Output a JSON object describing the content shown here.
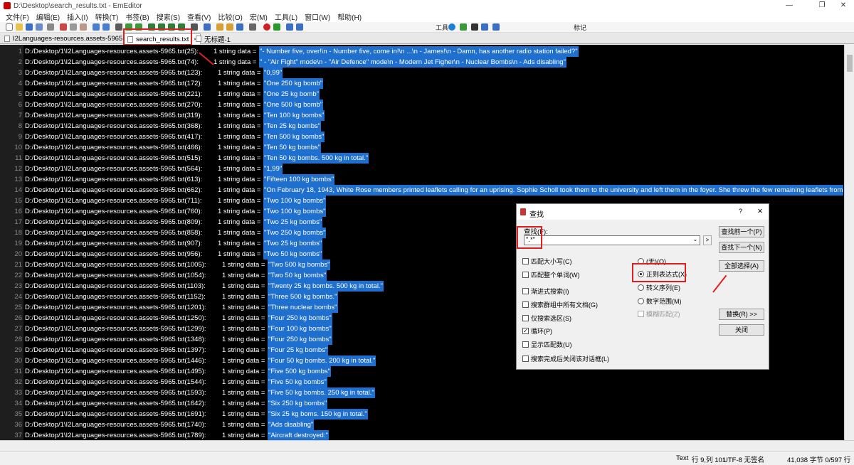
{
  "window": {
    "title": "D:\\Desktop\\search_results.txt - EmEditor",
    "minimize": "—",
    "maximize": "❐",
    "close": "✕"
  },
  "menu": [
    "文件(F)",
    "编辑(E)",
    "插入(I)",
    "转换(T)",
    "书签(B)",
    "搜索(S)",
    "查看(V)",
    "比较(O)",
    "宏(M)",
    "工具(L)",
    "窗口(W)",
    "帮助(H)"
  ],
  "toolbar": {
    "tools_label": "工具",
    "marks_label": "标记"
  },
  "tabs": [
    {
      "label": "I2Languages-resources.assets-5965.txt"
    },
    {
      "label": "search_results.txt",
      "close": "×"
    },
    {
      "label": "无标题-1"
    }
  ],
  "lines": [
    {
      "n": "1",
      "path": "D:/Desktop/1\\I2Languages-resources.assets-5965.txt(25):",
      "data": "1 string data = ",
      "sel": "\"- Number five, over!\\n - Number five, come in!\\n ...\\n - James!\\n - Damn, has another radio station failed?\""
    },
    {
      "n": "2",
      "path": "D:/Desktop/1\\I2Languages-resources.assets-5965.txt(74):",
      "data": "1 string data = ",
      "sel": "\" - \"Air Fight\" mode\\n - \"Air Defence\" mode\\n - Modern Jet Figher\\n - Nuclear Bombs\\n - Ads disabling\""
    },
    {
      "n": "3",
      "path": "D:/Desktop/1\\I2Languages-resources.assets-5965.txt(123):",
      "data": "1 string data = ",
      "sel": "\"0,99\""
    },
    {
      "n": "4",
      "path": "D:/Desktop/1\\I2Languages-resources.assets-5965.txt(172):",
      "data": "1 string data = ",
      "sel": "\"One 250 kg bomb\""
    },
    {
      "n": "5",
      "path": "D:/Desktop/1\\I2Languages-resources.assets-5965.txt(221):",
      "data": "1 string data = ",
      "sel": "\"One 25 kg bomb\""
    },
    {
      "n": "6",
      "path": "D:/Desktop/1\\I2Languages-resources.assets-5965.txt(270):",
      "data": "1 string data = ",
      "sel": "\"One 500 kg bomb\""
    },
    {
      "n": "7",
      "path": "D:/Desktop/1\\I2Languages-resources.assets-5965.txt(319):",
      "data": "1 string data = ",
      "sel": "\"Ten 100 kg bombs\""
    },
    {
      "n": "8",
      "path": "D:/Desktop/1\\I2Languages-resources.assets-5965.txt(368):",
      "data": "1 string data = ",
      "sel": "\"Ten 25 kg bombs\""
    },
    {
      "n": "9",
      "path": "D:/Desktop/1\\I2Languages-resources.assets-5965.txt(417):",
      "data": "1 string data = ",
      "sel": "\"Ten 500 kg bombs\""
    },
    {
      "n": "10",
      "path": "D:/Desktop/1\\I2Languages-resources.assets-5965.txt(466):",
      "data": "1 string data = ",
      "sel": "\"Ten 50 kg bombs\""
    },
    {
      "n": "11",
      "path": "D:/Desktop/1\\I2Languages-resources.assets-5965.txt(515):",
      "data": "1 string data = ",
      "sel": "\"Ten 50 kg bombs. 500 kg in total.\""
    },
    {
      "n": "12",
      "path": "D:/Desktop/1\\I2Languages-resources.assets-5965.txt(564):",
      "data": "1 string data = ",
      "sel": "\"1,99\""
    },
    {
      "n": "13",
      "path": "D:/Desktop/1\\I2Languages-resources.assets-5965.txt(613):",
      "data": "1 string data = ",
      "sel": "\"Fifteen 100 kg bombs\""
    },
    {
      "n": "14",
      "path": "D:/Desktop/1\\I2Languages-resources.assets-5965.txt(662):",
      "data": "1 string data = ",
      "sel": "\"On February 18, 1943, White Rose members printed leaflets calling for an uprising. Sophie Scholl took them to the university and left them in the foyer. She threw the few remaining leaflets from"
    },
    {
      "n": "15",
      "path": "D:/Desktop/1\\I2Languages-resources.assets-5965.txt(711):",
      "data": "1 string data = ",
      "sel": "\"Two 100 kg bombs\""
    },
    {
      "n": "16",
      "path": "D:/Desktop/1\\I2Languages-resources.assets-5965.txt(760):",
      "data": "1 string data = ",
      "sel": "\"Two 100 kg bombs\""
    },
    {
      "n": "17",
      "path": "D:/Desktop/1\\I2Languages-resources.assets-5965.txt(809):",
      "data": "1 string data = ",
      "sel": "\"Two 25 kg bombs\""
    },
    {
      "n": "18",
      "path": "D:/Desktop/1\\I2Languages-resources.assets-5965.txt(858):",
      "data": "1 string data = ",
      "sel": "\"Two 250 kg bombs\""
    },
    {
      "n": "19",
      "path": "D:/Desktop/1\\I2Languages-resources.assets-5965.txt(907):",
      "data": "1 string data = ",
      "sel": "\"Two 25 kg bombs\""
    },
    {
      "n": "20",
      "path": "D:/Desktop/1\\I2Languages-resources.assets-5965.txt(956):",
      "data": "1 string data = ",
      "sel": "\"Two 50 kg bombs\""
    },
    {
      "n": "21",
      "path": "D:/Desktop/1\\I2Languages-resources.assets-5965.txt(1005):",
      "data": "1 string data = ",
      "sel": "\"Two 500 kg bombs\""
    },
    {
      "n": "22",
      "path": "D:/Desktop/1\\I2Languages-resources.assets-5965.txt(1054):",
      "data": "1 string data = ",
      "sel": "\"Two 50 kg bombs\""
    },
    {
      "n": "23",
      "path": "D:/Desktop/1\\I2Languages-resources.assets-5965.txt(1103):",
      "data": "1 string data = ",
      "sel": "\"Twenty 25 kg bombs. 500 kg in total.\""
    },
    {
      "n": "24",
      "path": "D:/Desktop/1\\I2Languages-resources.assets-5965.txt(1152):",
      "data": "1 string data = ",
      "sel": "\"Three 500 kg bombs.\""
    },
    {
      "n": "25",
      "path": "D:/Desktop/1\\I2Languages-resources.assets-5965.txt(1201):",
      "data": "1 string data = ",
      "sel": "\"Three nuclear bombs\""
    },
    {
      "n": "26",
      "path": "D:/Desktop/1\\I2Languages-resources.assets-5965.txt(1250):",
      "data": "1 string data = ",
      "sel": "\"Four 250 kg bombs\""
    },
    {
      "n": "27",
      "path": "D:/Desktop/1\\I2Languages-resources.assets-5965.txt(1299):",
      "data": "1 string data = ",
      "sel": "\"Four 100 kg bombs\""
    },
    {
      "n": "28",
      "path": "D:/Desktop/1\\I2Languages-resources.assets-5965.txt(1348):",
      "data": "1 string data = ",
      "sel": "\"Four 250 kg bombs\""
    },
    {
      "n": "29",
      "path": "D:/Desktop/1\\I2Languages-resources.assets-5965.txt(1397):",
      "data": "1 string data = ",
      "sel": "\"Four 25 kg bombs\""
    },
    {
      "n": "30",
      "path": "D:/Desktop/1\\I2Languages-resources.assets-5965.txt(1446):",
      "data": "1 string data = ",
      "sel": "\"Four 50 kg bombs. 200 kg in total.\""
    },
    {
      "n": "31",
      "path": "D:/Desktop/1\\I2Languages-resources.assets-5965.txt(1495):",
      "data": "1 string data = ",
      "sel": "\"Five 500 kg bombs\""
    },
    {
      "n": "32",
      "path": "D:/Desktop/1\\I2Languages-resources.assets-5965.txt(1544):",
      "data": "1 string data = ",
      "sel": "\"Five 50 kg bombs\""
    },
    {
      "n": "33",
      "path": "D:/Desktop/1\\I2Languages-resources.assets-5965.txt(1593):",
      "data": "1 string data = ",
      "sel": "\"Five 50 kg bombs. 250 kg in total.\""
    },
    {
      "n": "34",
      "path": "D:/Desktop/1\\I2Languages-resources.assets-5965.txt(1642):",
      "data": "1 string data = ",
      "sel": "\"Six 250 kg bombs\""
    },
    {
      "n": "35",
      "path": "D:/Desktop/1\\I2Languages-resources.assets-5965.txt(1691):",
      "data": "1 string data = ",
      "sel": "\"Six 25 kg boms. 150 kg in total.\""
    },
    {
      "n": "36",
      "path": "D:/Desktop/1\\I2Languages-resources.assets-5965.txt(1740):",
      "data": "1 string data = ",
      "sel": "\"Ads disabling\""
    },
    {
      "n": "37",
      "path": "D:/Desktop/1\\I2Languages-resources.assets-5965.txt(1789):",
      "data": "1 string data = ",
      "sel": "\"Aircraft destroyed:\""
    }
  ],
  "status": {
    "mode": "Text",
    "position": "行 9,列 101",
    "encoding": "UTF-8 无签名",
    "count": "41,038 字节 0/597 行"
  },
  "find_dialog": {
    "title": "查找",
    "help": "?",
    "close": "✕",
    "find_label": "查找(F):",
    "find_value": "\".*\"",
    "dropdown": "⌄",
    "side_arrow": ">",
    "buttons": {
      "find_prev": "查找前一个(P)",
      "find_next": "查找下一个(N)",
      "select_all": "全部选择(A)",
      "replace": "替换(R) >>",
      "close": "关闭"
    },
    "checkboxes": [
      {
        "label": "匹配大小写(C)",
        "checked": false
      },
      {
        "label": "匹配整个单词(W)",
        "checked": false
      },
      {
        "label": "渐进式搜索(I)",
        "checked": false
      },
      {
        "label": "搜索群组中所有文档(G)",
        "checked": false
      },
      {
        "label": "仅搜索选区(S)",
        "checked": false
      },
      {
        "label": "循环(P)",
        "checked": true
      },
      {
        "label": "显示匹配数(U)",
        "checked": false
      },
      {
        "label": "搜索完成后关闭该对话框(L)",
        "checked": false
      }
    ],
    "radios": [
      {
        "label": "(无)(O)",
        "selected": false
      },
      {
        "label": "正则表达式(X)",
        "selected": true
      },
      {
        "label": "转义序列(E)",
        "selected": false
      },
      {
        "label": "数字范围(M)",
        "selected": false
      }
    ],
    "fuzzy": {
      "label": "模糊匹配(Z)",
      "checked": false
    }
  },
  "colors": {
    "selection": "#1f6fcf",
    "annotation": "#e02020",
    "editor_bg": "#000000"
  }
}
